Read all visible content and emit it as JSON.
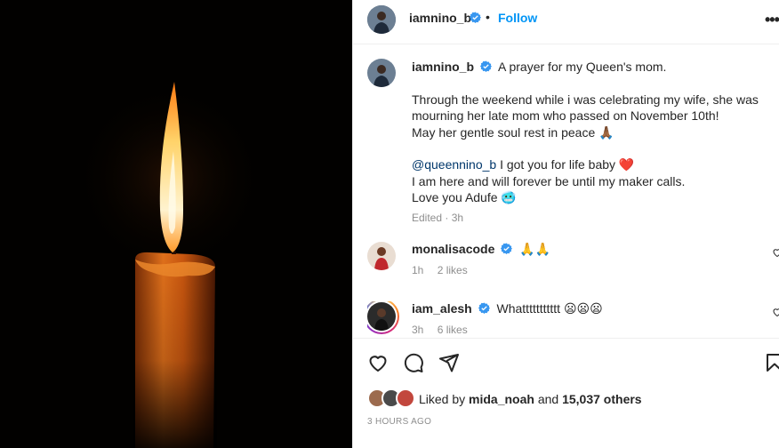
{
  "post": {
    "author": "iamnino_b",
    "follow_label": "Follow",
    "dot": "•",
    "more": "•••",
    "caption": {
      "line1": "A prayer for my Queen's mom.",
      "line2": "Through the weekend while i was celebrating my wife, she was",
      "line3": "mourning her late mom who passed on November 10th!",
      "line4": "May her gentle soul rest in peace 🙏🏾",
      "mention": "@queennino_b",
      "line5_rest": " I got you for life baby ❤️",
      "line6": "I am here and will forever be until my maker calls.",
      "line7": "Love you Adufe 🥶",
      "edited": "Edited · 3h"
    }
  },
  "comments": [
    {
      "user": "monalisacode",
      "text": "🙏🙏",
      "time": "1h",
      "likes": "2 likes"
    },
    {
      "user": "iam_alesh",
      "text": "Whattttttttttt 😦😦😦",
      "time": "3h",
      "likes": "6 likes"
    }
  ],
  "footer": {
    "liked_prefix": "Liked by ",
    "liked_user": "mida_noah",
    "liked_mid": " and ",
    "liked_count": "15,037 others",
    "time": "3 HOURS AGO"
  },
  "colors": {
    "accent": "#0095f6",
    "verified": "#3897f0",
    "heart": "#ed4956"
  }
}
